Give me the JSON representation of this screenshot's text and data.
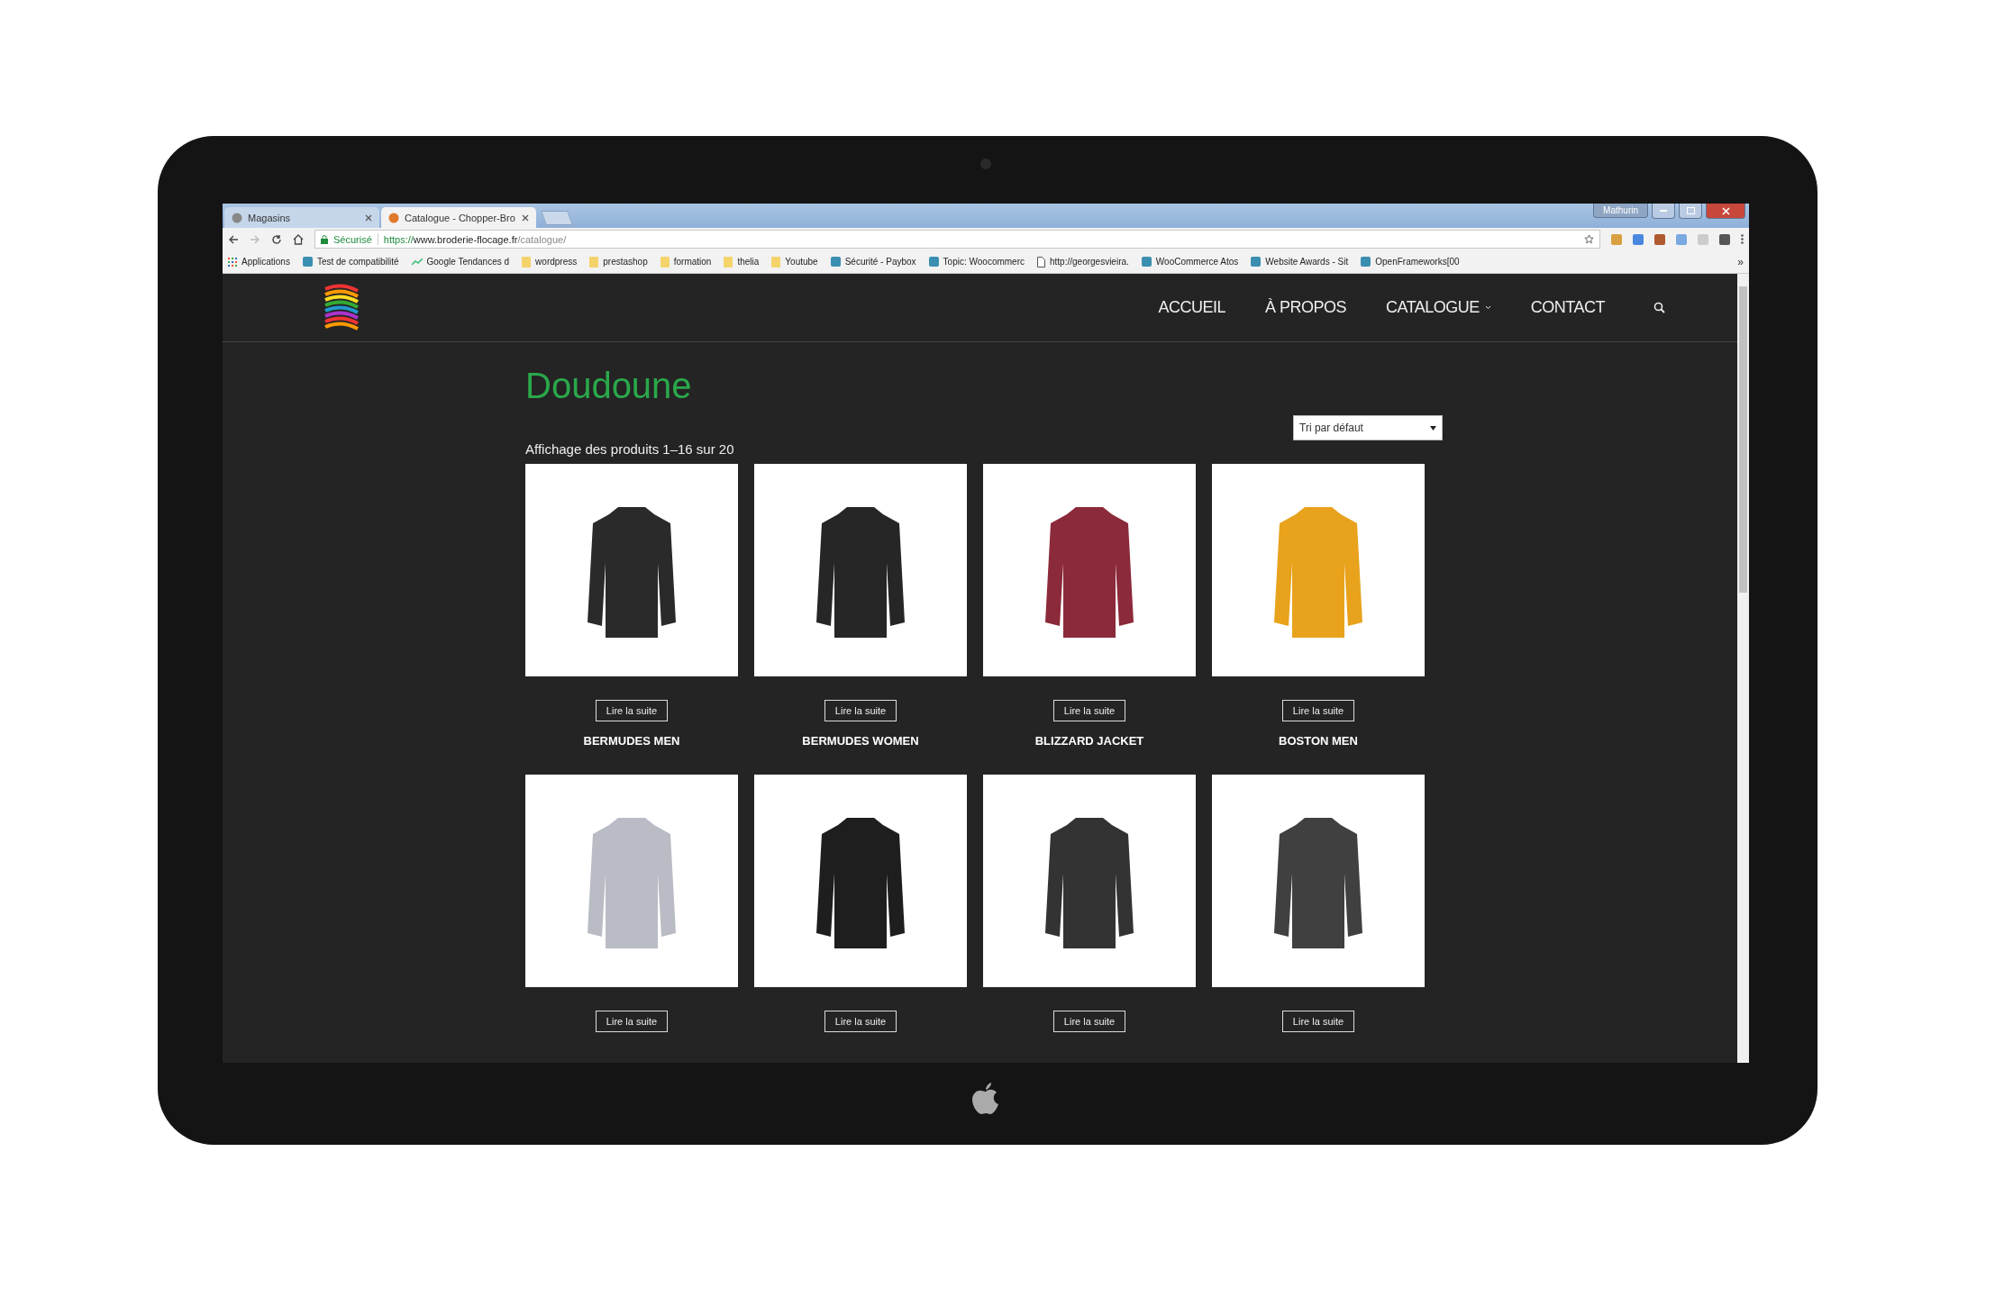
{
  "browser": {
    "tabs": [
      {
        "title": "Magasins",
        "selected": false
      },
      {
        "title": "Catalogue - Chopper-Bro",
        "selected": true
      }
    ],
    "profile": "Mathurin",
    "address": {
      "secure_label": "Sécurisé",
      "scheme": "https://",
      "host": "www.broderie-flocage.fr",
      "path": "/catalogue/"
    },
    "bookmarks": [
      {
        "label": "Applications",
        "kind": "apps"
      },
      {
        "label": "Test de compatibilité",
        "kind": "site"
      },
      {
        "label": "Google Tendances d",
        "kind": "trend"
      },
      {
        "label": "wordpress",
        "kind": "folder"
      },
      {
        "label": "prestashop",
        "kind": "folder"
      },
      {
        "label": "formation",
        "kind": "folder"
      },
      {
        "label": "thelia",
        "kind": "folder"
      },
      {
        "label": "Youtube",
        "kind": "folder"
      },
      {
        "label": "Sécurité - Paybox",
        "kind": "site"
      },
      {
        "label": "Topic: Woocommerc",
        "kind": "site"
      },
      {
        "label": "http://georgesvieira.",
        "kind": "page"
      },
      {
        "label": "WooCommerce Atos",
        "kind": "site"
      },
      {
        "label": "Website Awards - Sit",
        "kind": "site"
      },
      {
        "label": "OpenFrameworks[00",
        "kind": "site"
      }
    ],
    "bookmarks_more": "»"
  },
  "site": {
    "nav": [
      {
        "label": "ACCUEIL",
        "has_menu": false
      },
      {
        "label": "À PROPOS",
        "has_menu": false
      },
      {
        "label": "CATALOGUE",
        "has_menu": true
      },
      {
        "label": "CONTACT",
        "has_menu": false
      }
    ],
    "title": "Doudoune",
    "result_count": "Affichage des produits 1–16 sur 20",
    "sort": {
      "value": "Tri par défaut"
    },
    "products": [
      {
        "name": "BERMUDES MEN",
        "button": "Lire la suite"
      },
      {
        "name": "BERMUDES WOMEN",
        "button": "Lire la suite"
      },
      {
        "name": "BLIZZARD JACKET",
        "button": "Lire la suite"
      },
      {
        "name": "BOSTON MEN",
        "button": "Lire la suite"
      },
      {
        "button": "Lire la suite"
      },
      {
        "button": "Lire la suite"
      },
      {
        "button": "Lire la suite"
      },
      {
        "button": "Lire la suite"
      }
    ]
  }
}
